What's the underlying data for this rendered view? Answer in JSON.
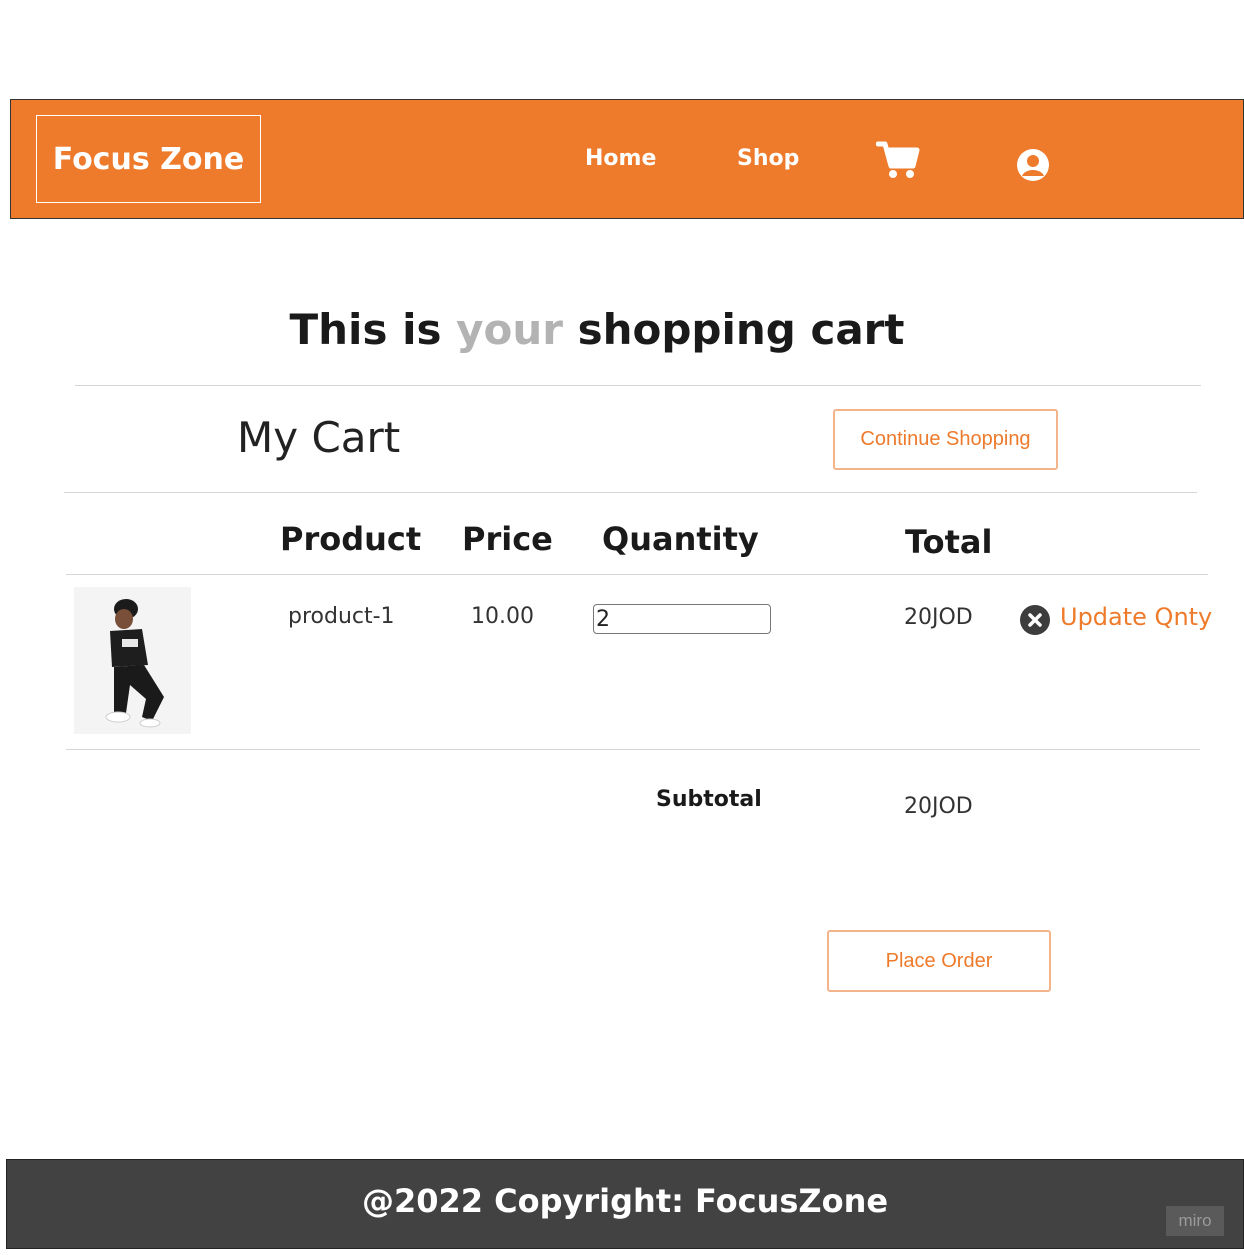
{
  "header": {
    "logo": "Focus Zone",
    "nav": {
      "home": "Home",
      "shop": "Shop"
    },
    "icons": {
      "cart": "shopping-cart-icon",
      "account": "user-circle-icon"
    },
    "accent_color": "#ee7a2b"
  },
  "headline": {
    "part1": "This is ",
    "part2": "your",
    "part3": " shopping cart"
  },
  "cart": {
    "title": "My Cart",
    "continue_button": "Continue Shopping",
    "columns": {
      "product": "Product",
      "price": "Price",
      "quantity": "Quantity",
      "total": "Total"
    },
    "items": [
      {
        "name": "product-1",
        "price": "10.00",
        "quantity": "2",
        "total": "20JOD",
        "update_label": "Update Qnty"
      }
    ],
    "subtotal_label": "Subtotal",
    "subtotal_value": "20JOD",
    "place_order_button": "Place Order"
  },
  "footer": {
    "text": "@2022 Copyright: FocusZone",
    "watermark": "miro"
  }
}
